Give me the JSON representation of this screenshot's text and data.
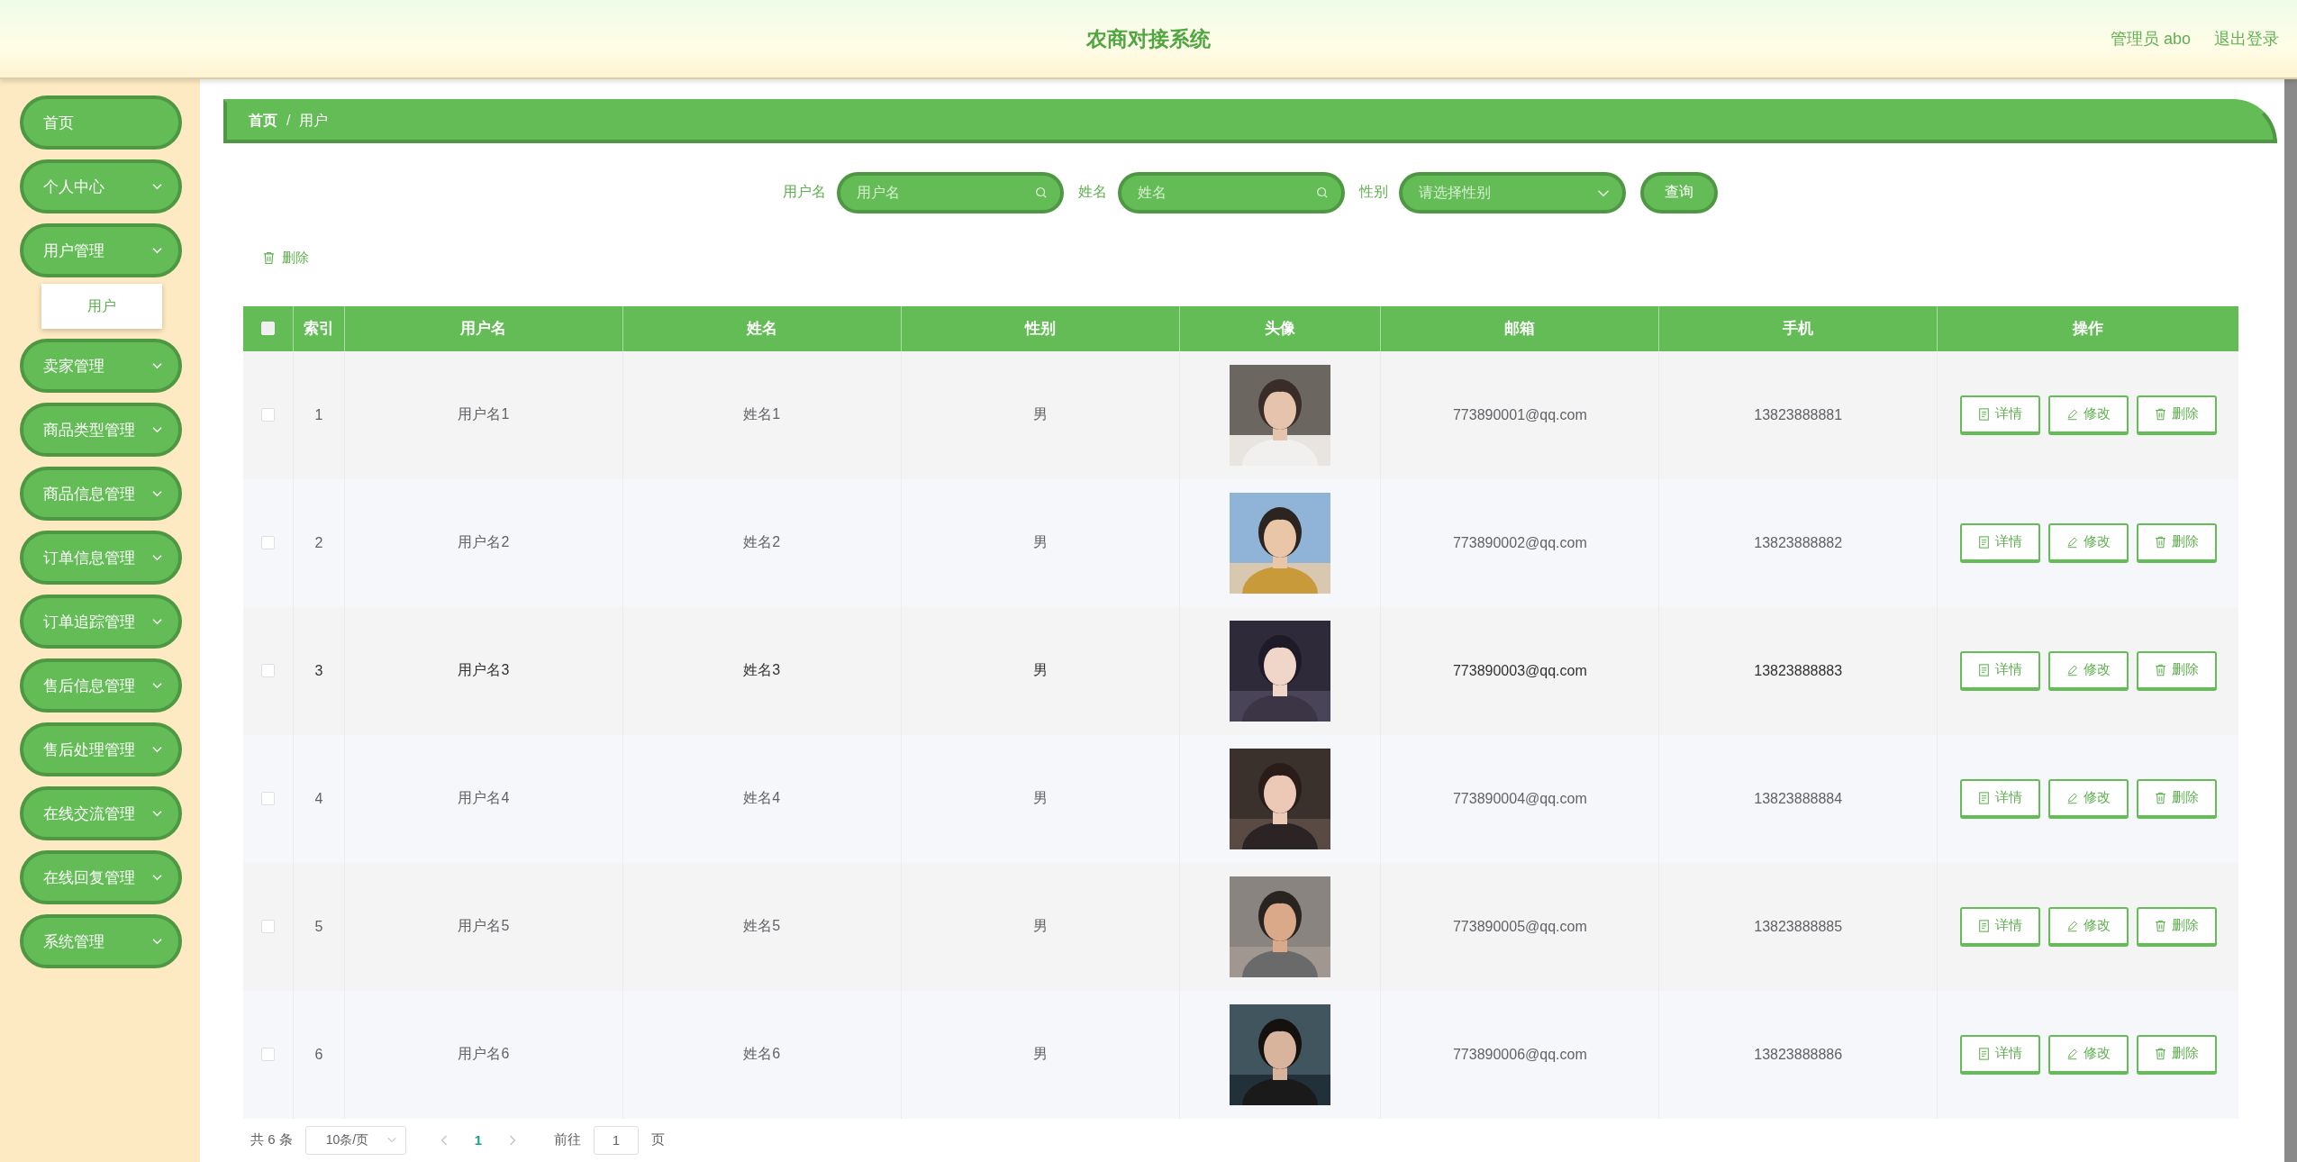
{
  "header": {
    "title": "农商对接系统",
    "user": "管理员 abo",
    "logout": "退出登录"
  },
  "sidebar": {
    "items": [
      {
        "label": "首页",
        "kind": "link"
      },
      {
        "label": "个人中心",
        "kind": "submenu"
      },
      {
        "label": "用户管理",
        "kind": "submenu",
        "children": [
          {
            "label": "用户"
          }
        ]
      },
      {
        "label": "卖家管理",
        "kind": "submenu"
      },
      {
        "label": "商品类型管理",
        "kind": "submenu"
      },
      {
        "label": "商品信息管理",
        "kind": "submenu"
      },
      {
        "label": "订单信息管理",
        "kind": "submenu"
      },
      {
        "label": "订单追踪管理",
        "kind": "submenu"
      },
      {
        "label": "售后信息管理",
        "kind": "submenu"
      },
      {
        "label": "售后处理管理",
        "kind": "submenu"
      },
      {
        "label": "在线交流管理",
        "kind": "submenu"
      },
      {
        "label": "在线回复管理",
        "kind": "submenu"
      },
      {
        "label": "系统管理",
        "kind": "submenu"
      }
    ]
  },
  "breadcrumb": [
    "首页",
    "用户"
  ],
  "breadcrumb_separator": "/",
  "search": {
    "fields": [
      {
        "label": "用户名",
        "placeholder": "用户名",
        "kind": "input"
      },
      {
        "label": "姓名",
        "placeholder": "姓名",
        "kind": "input"
      },
      {
        "label": "性别",
        "placeholder": "请选择性别",
        "kind": "select"
      }
    ],
    "button": "查询"
  },
  "delete_button": "删除",
  "table": {
    "select_all_checked": false,
    "columns": [
      "索引",
      "用户名",
      "姓名",
      "性别",
      "头像",
      "邮箱",
      "手机",
      "操作"
    ],
    "rows": [
      {
        "checked": false,
        "highlighted": false,
        "index": "1",
        "username": "用户名1",
        "name": "姓名1",
        "gender": "男",
        "email": "773890001@qq.com",
        "phone": "13823888881",
        "actions": [
          "详情",
          "修改",
          "删除"
        ]
      },
      {
        "checked": false,
        "highlighted": false,
        "index": "2",
        "username": "用户名2",
        "name": "姓名2",
        "gender": "男",
        "email": "773890002@qq.com",
        "phone": "13823888882",
        "actions": [
          "详情",
          "修改",
          "删除"
        ]
      },
      {
        "checked": false,
        "highlighted": true,
        "index": "3",
        "username": "用户名3",
        "name": "姓名3",
        "gender": "男",
        "email": "773890003@qq.com",
        "phone": "13823888883",
        "actions": [
          "详情",
          "修改",
          "删除"
        ]
      },
      {
        "checked": false,
        "highlighted": false,
        "index": "4",
        "username": "用户名4",
        "name": "姓名4",
        "gender": "男",
        "email": "773890004@qq.com",
        "phone": "13823888884",
        "actions": [
          "详情",
          "修改",
          "删除"
        ]
      },
      {
        "checked": false,
        "highlighted": false,
        "index": "5",
        "username": "用户名5",
        "name": "姓名5",
        "gender": "男",
        "email": "773890005@qq.com",
        "phone": "13823888885",
        "actions": [
          "详情",
          "修改",
          "删除"
        ]
      },
      {
        "checked": false,
        "highlighted": false,
        "index": "6",
        "username": "用户名6",
        "name": "姓名6",
        "gender": "男",
        "email": "773890006@qq.com",
        "phone": "13823888886",
        "actions": [
          "详情",
          "修改",
          "删除"
        ]
      }
    ]
  },
  "pagination": {
    "total": "共 6 条",
    "page_size": "10条/页",
    "pages": [
      {
        "label": "1",
        "selected": true
      }
    ],
    "goto_label": "前往",
    "goto_value": "1",
    "goto_suffix": "页"
  }
}
